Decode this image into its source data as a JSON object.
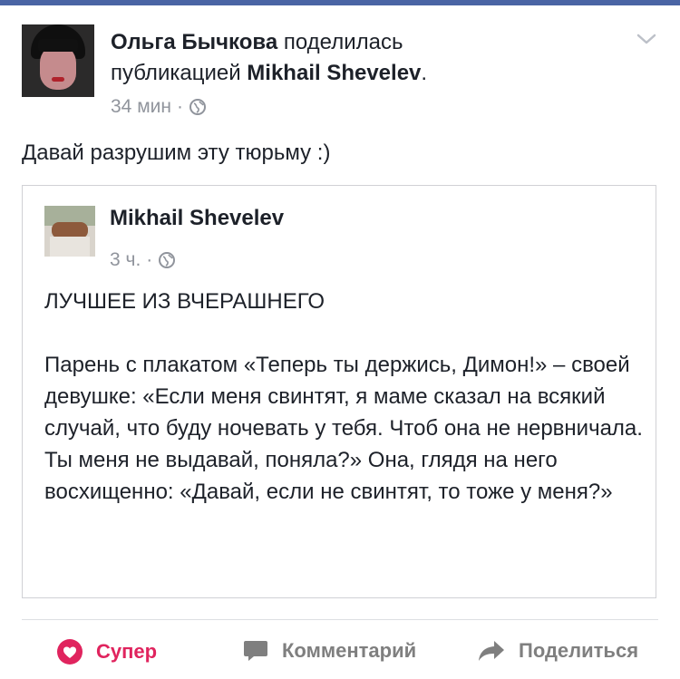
{
  "header": {
    "author_name": "Ольга Бычкова",
    "shared_text": " поделилась ",
    "shared_text_2": "публикацией ",
    "shared_author": "Mikhail Shevelev",
    "period": ".",
    "time": "34 мин",
    "sep": "·",
    "audience_icon": "globe-icon",
    "menu_icon": "chevron-down-icon"
  },
  "post": {
    "text": "Давай разрушим эту тюрьму :)"
  },
  "shared_post": {
    "author_name": "Mikhail Shevelev",
    "time": "3 ч.",
    "sep": "·",
    "title": "ЛУЧШЕЕ ИЗ ВЧЕРАШНЕГО",
    "body": "Парень с плакатом «Теперь ты держись, Димон!» – своей девушке: «Если меня свинтят, я маме сказал на всякий случай, что буду ночевать у тебя. Чтоб она не нервничала. Ты меня не выдавай, поняла?» Она, глядя на него восхищенно: «Давай, если не свинтят, то тоже у меня?»"
  },
  "actions": {
    "like_label": "Супер",
    "comment_label": "Комментарий",
    "share_label": "Поделиться"
  },
  "colors": {
    "topbar": "#4a64a4",
    "like": "#e0245e",
    "meta": "#90949c",
    "action": "#7f7f7f"
  }
}
